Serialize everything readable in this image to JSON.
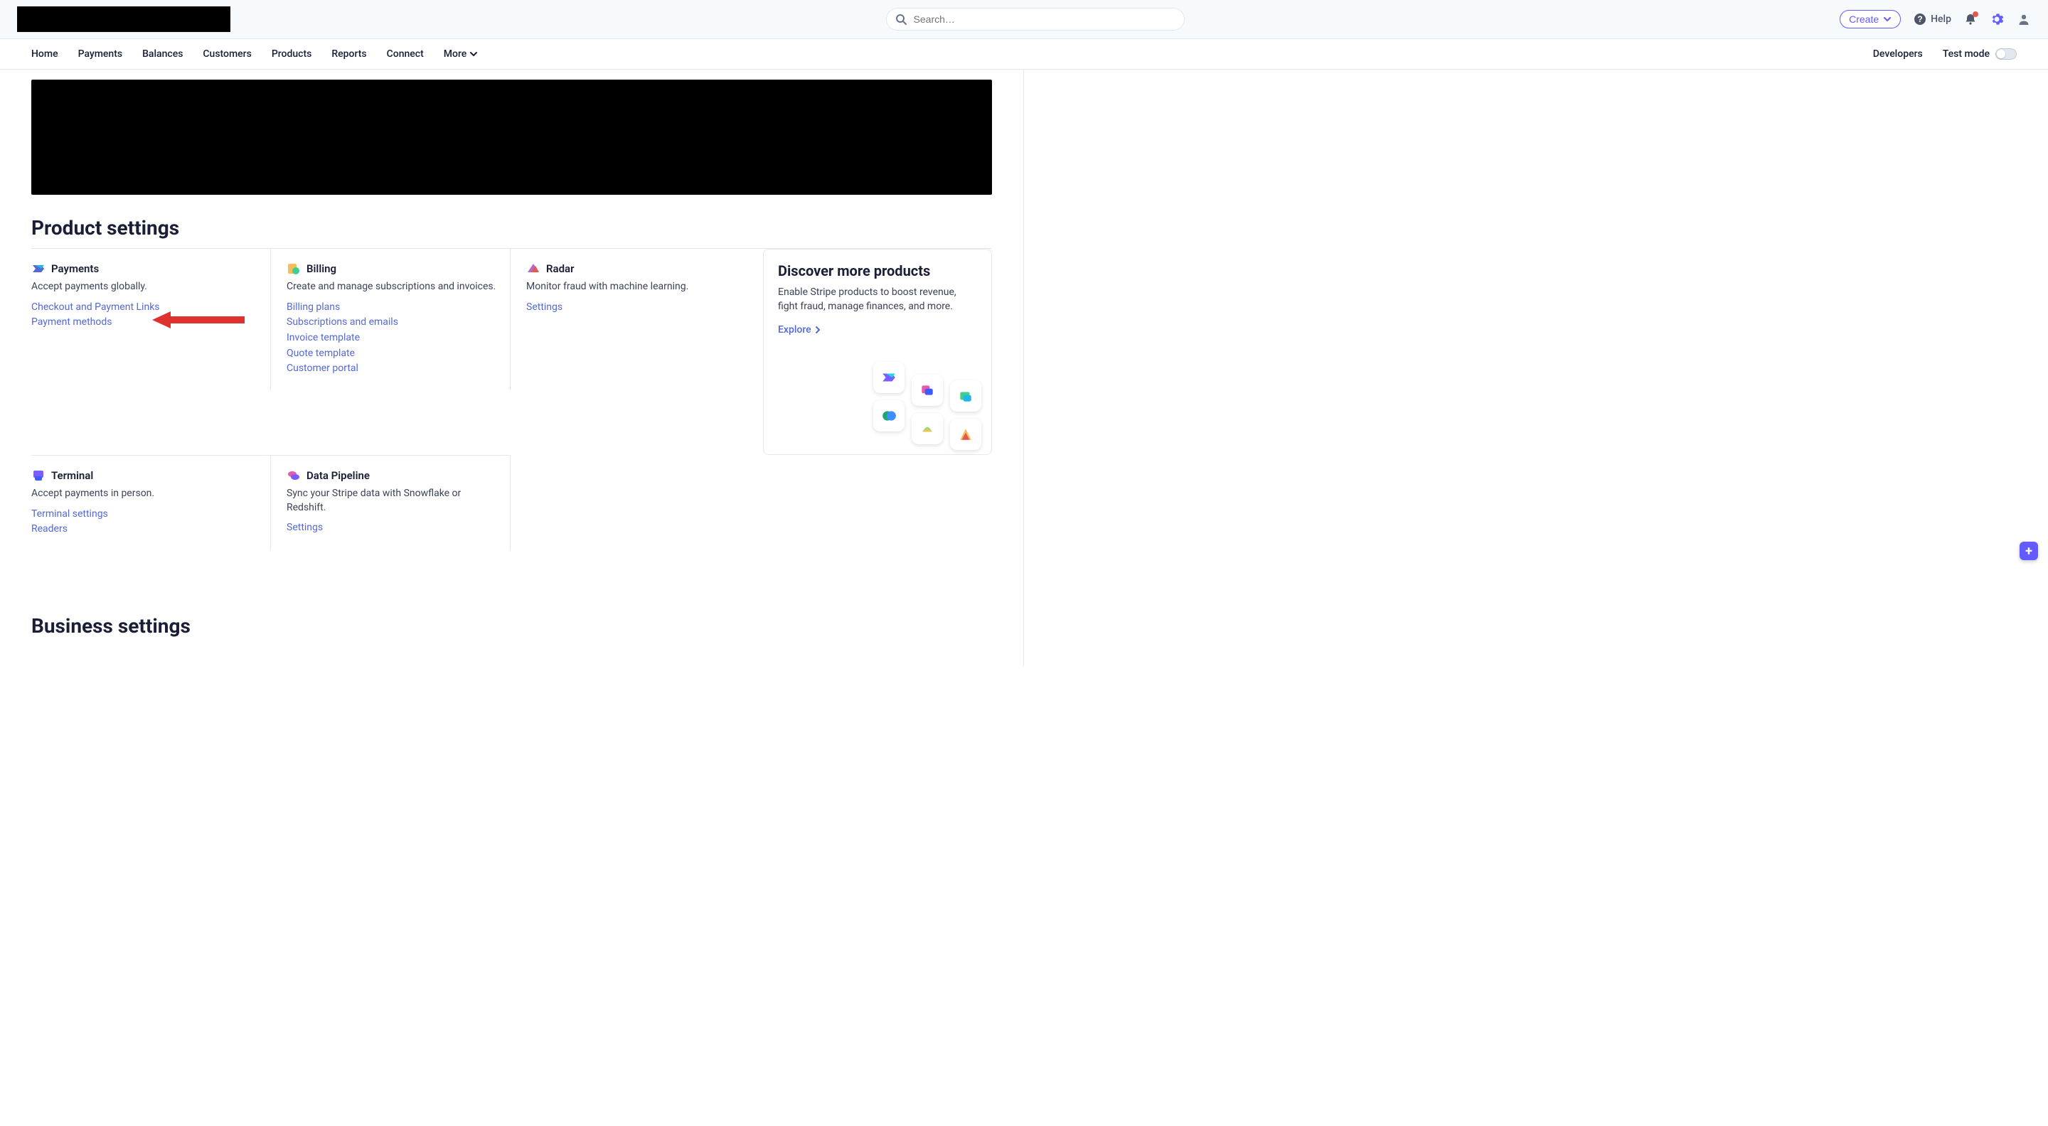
{
  "header": {
    "search_placeholder": "Search…",
    "create_label": "Create",
    "help_label": "Help"
  },
  "nav": {
    "items": [
      "Home",
      "Payments",
      "Balances",
      "Customers",
      "Products",
      "Reports",
      "Connect"
    ],
    "more_label": "More",
    "developers_label": "Developers",
    "test_mode_label": "Test mode",
    "test_mode_on": false
  },
  "page": {
    "section_title": "Product settings",
    "section_title_2": "Business settings"
  },
  "products": {
    "payments": {
      "title": "Payments",
      "desc": "Accept payments globally.",
      "links": [
        "Checkout and Payment Links",
        "Payment methods"
      ]
    },
    "billing": {
      "title": "Billing",
      "desc": "Create and manage subscriptions and invoices.",
      "links": [
        "Billing plans",
        "Subscriptions and emails",
        "Invoice template",
        "Quote template",
        "Customer portal"
      ]
    },
    "radar": {
      "title": "Radar",
      "desc": "Monitor fraud with machine learning.",
      "links": [
        "Settings"
      ]
    },
    "terminal": {
      "title": "Terminal",
      "desc": "Accept payments in person.",
      "links": [
        "Terminal settings",
        "Readers"
      ]
    },
    "data_pipeline": {
      "title": "Data Pipeline",
      "desc": "Sync your Stripe data with Snowflake or Redshift.",
      "links": [
        "Settings"
      ]
    }
  },
  "promo": {
    "title": "Discover more products",
    "desc": "Enable Stripe products to boost revenue, fight fraud, manage finances, and more.",
    "cta": "Explore"
  },
  "annotation": {
    "arrow_target": "Payment methods"
  }
}
